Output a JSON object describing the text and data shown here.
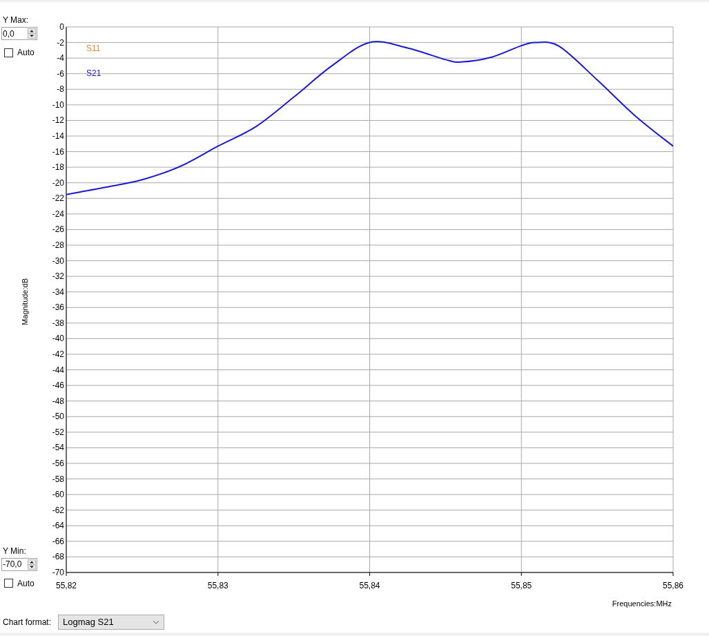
{
  "y_max": {
    "label": "Y Max:",
    "value": "0,0",
    "auto": {
      "label": "Auto",
      "checked": false
    }
  },
  "y_min": {
    "label": "Y Min:",
    "value": "-70,0",
    "auto": {
      "label": "Auto",
      "checked": false
    }
  },
  "chart": {
    "chart_data": {
      "type": "line",
      "xlabel": "Frequencies:MHz",
      "ylabel": "Magnitude:dB",
      "grid": true,
      "x": [
        55.82,
        55.8225,
        55.825,
        55.8275,
        55.83,
        55.8325,
        55.835,
        55.8375,
        55.84,
        55.8425,
        55.845,
        55.846,
        55.848,
        55.85,
        55.851,
        55.8525,
        55.855,
        55.8575,
        55.86
      ],
      "series": [
        {
          "name": "S11",
          "color": "#e8882a",
          "values": [
            null,
            null,
            null,
            null,
            null,
            null,
            null,
            null,
            null,
            null,
            null,
            null,
            null,
            null,
            null,
            null,
            null,
            null,
            null
          ]
        },
        {
          "name": "S21",
          "color": "#1a1ad0",
          "values": [
            -21.5,
            -20.6,
            -19.6,
            -17.9,
            -15.3,
            -12.8,
            -9.0,
            -5.0,
            -2.0,
            -2.7,
            -4.2,
            -4.5,
            -3.9,
            -2.4,
            -2.0,
            -2.5,
            -6.8,
            -11.4,
            -15.3
          ]
        }
      ],
      "xlim": [
        55.82,
        55.86
      ],
      "ylim": [
        -70,
        0
      ],
      "xticks": [
        {
          "value": 55.82,
          "label": "55,82"
        },
        {
          "value": 55.83,
          "label": "55,83"
        },
        {
          "value": 55.84,
          "label": "55,84"
        },
        {
          "value": 55.85,
          "label": "55,85"
        },
        {
          "value": 55.86,
          "label": "55,86"
        }
      ],
      "yticks": [
        0,
        -2,
        -4,
        -6,
        -8,
        -10,
        -12,
        -14,
        -16,
        -18,
        -20,
        -22,
        -24,
        -26,
        -28,
        -30,
        -32,
        -34,
        -36,
        -38,
        -40,
        -42,
        -44,
        -46,
        -48,
        -50,
        -52,
        -54,
        -56,
        -58,
        -60,
        -62,
        -64,
        -66,
        -68,
        -70
      ]
    }
  },
  "chart_format": {
    "label": "Chart format:",
    "value": "Logmag S21"
  }
}
